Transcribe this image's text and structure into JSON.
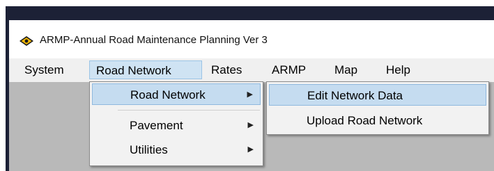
{
  "window": {
    "title": "ARMP-Annual Road Maintenance Planning Ver 3",
    "icon": "armp-app-icon"
  },
  "menubar": {
    "items": [
      {
        "label": "System"
      },
      {
        "label": "Road Network",
        "active": true
      },
      {
        "label": "Rates"
      },
      {
        "label": "ARMP"
      },
      {
        "label": "Map"
      },
      {
        "label": "Help"
      }
    ]
  },
  "submenu_road_network": {
    "items": [
      {
        "label": "Road Network",
        "has_submenu": true,
        "highlighted": true
      },
      {
        "label": "Pavement",
        "has_submenu": true
      },
      {
        "label": "Utilities",
        "has_submenu": true
      }
    ]
  },
  "submenu_nested": {
    "items": [
      {
        "label": "Edit Network Data",
        "highlighted": true
      },
      {
        "label": "Upload Road Network"
      }
    ]
  },
  "colors": {
    "frame": "#1c2136",
    "highlight": "#c5dcf0",
    "client_area": "#b9b9b9",
    "menubar": "#f0f0f0"
  }
}
